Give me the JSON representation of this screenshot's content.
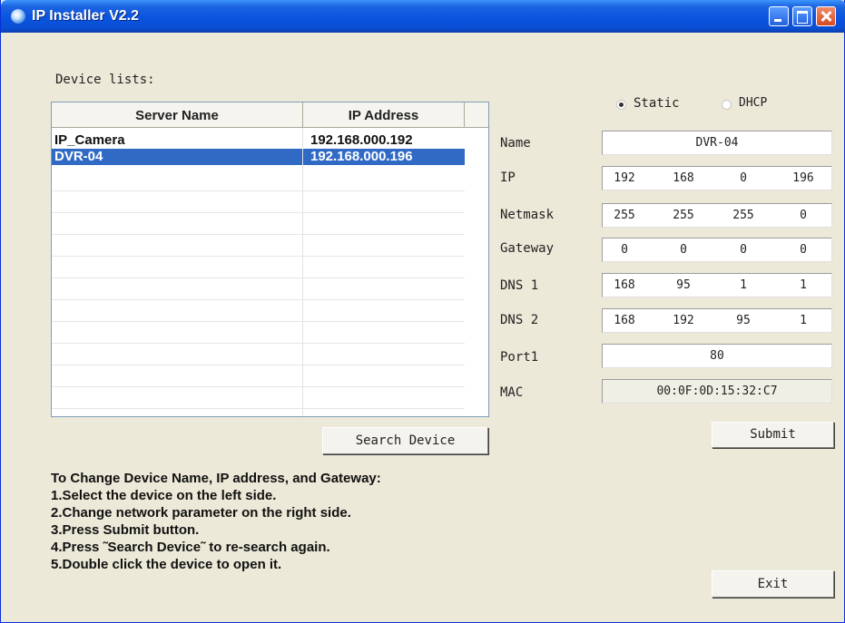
{
  "window": {
    "title": "IP Installer V2.2"
  },
  "device_list": {
    "label": "Device lists:",
    "columns": [
      "Server Name",
      "IP Address"
    ],
    "rows": [
      {
        "name": "IP_Camera",
        "ip": "192.168.000.192",
        "selected": false
      },
      {
        "name": "DVR-04",
        "ip": "192.168.000.196",
        "selected": true
      }
    ]
  },
  "buttons": {
    "search": "Search Device",
    "submit": "Submit",
    "exit": "Exit"
  },
  "mode": {
    "static_label": "Static",
    "dhcp_label": "DHCP",
    "selected": "Static"
  },
  "settings": {
    "name_label": "Name",
    "name": "DVR-04",
    "ip_label": "IP",
    "ip": [
      "192",
      "168",
      "0",
      "196"
    ],
    "netmask_label": "Netmask",
    "netmask": [
      "255",
      "255",
      "255",
      "0"
    ],
    "gateway_label": "Gateway",
    "gateway": [
      "0",
      "0",
      "0",
      "0"
    ],
    "dns1_label": "DNS 1",
    "dns1": [
      "168",
      "95",
      "1",
      "1"
    ],
    "dns2_label": "DNS 2",
    "dns2": [
      "168",
      "192",
      "95",
      "1"
    ],
    "port_label": "Port1",
    "port": "80",
    "mac_label": "MAC",
    "mac": "00:0F:0D:15:32:C7"
  },
  "instructions": [
    "To Change Device Name, IP address, and Gateway:",
    "1.Select the device on the left side.",
    "2.Change network parameter on the right side.",
    "3.Press Submit button.",
    "4.Press ˜Search Device˜ to re-search again.",
    "5.Double click the device to open it."
  ],
  "colors": {
    "titlebar": "#0a54e0",
    "selection": "#316AC5",
    "window_bg": "#ECE9D8"
  }
}
